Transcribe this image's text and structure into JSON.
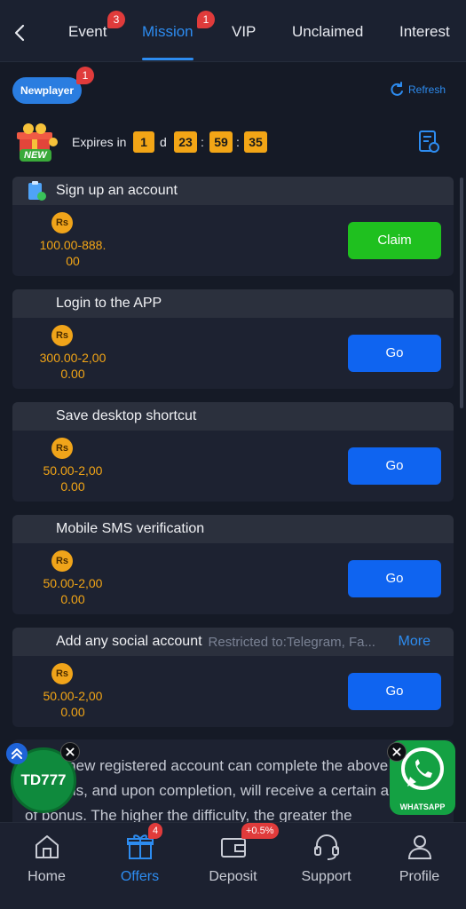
{
  "tabs": [
    {
      "label": "Event",
      "badge": "3"
    },
    {
      "label": "Mission",
      "badge": "1",
      "active": true
    },
    {
      "label": "VIP"
    },
    {
      "label": "Unclaimed"
    },
    {
      "label": "Interest"
    }
  ],
  "newplayer": {
    "label": "Newplayer",
    "badge": "1"
  },
  "refresh_label": "Refresh",
  "gift_tag": "NEW",
  "expiry": {
    "label": "Expires in",
    "days": "1",
    "day_unit": "d",
    "hours": "23",
    "minutes": "59",
    "seconds": "35"
  },
  "currency_label": "Rs",
  "missions": [
    {
      "title": "Sign up an account",
      "amount_line1": "100.00-888.",
      "amount_line2": "00",
      "action": "Claim",
      "action_type": "claim"
    },
    {
      "title": "Login to the APP",
      "amount_line1": "300.00-2,00",
      "amount_line2": "0.00",
      "action": "Go",
      "action_type": "go"
    },
    {
      "title": "Save desktop shortcut",
      "amount_line1": "50.00-2,00",
      "amount_line2": "0.00",
      "action": "Go",
      "action_type": "go"
    },
    {
      "title": "Mobile SMS verification",
      "amount_line1": "50.00-2,00",
      "amount_line2": "0.00",
      "action": "Go",
      "action_type": "go"
    },
    {
      "title": "Add any social account",
      "restriction": "Restricted to:Telegram, Fa...",
      "more": "More",
      "amount_line1": "50.00-2,00",
      "amount_line2": "0.00",
      "action": "Go",
      "action_type": "go"
    }
  ],
  "description": "Every new registered account can complete the above missions, and upon completion, will receive a certain amount of bonus. The higher the difficulty, the greater the",
  "floating": {
    "td_label": "TD777",
    "whatsapp_label": "WHATSAPP"
  },
  "bottom_nav": [
    {
      "label": "Home"
    },
    {
      "label": "Offers",
      "badge": "4",
      "active": true
    },
    {
      "label": "Deposit",
      "badge": "+0.5%"
    },
    {
      "label": "Support"
    },
    {
      "label": "Profile"
    }
  ],
  "colors": {
    "accent": "#2d8cf0",
    "claim": "#1fc01f",
    "go": "#0f64f0",
    "countdown": "#f2a516",
    "badge": "#e03b3b"
  }
}
